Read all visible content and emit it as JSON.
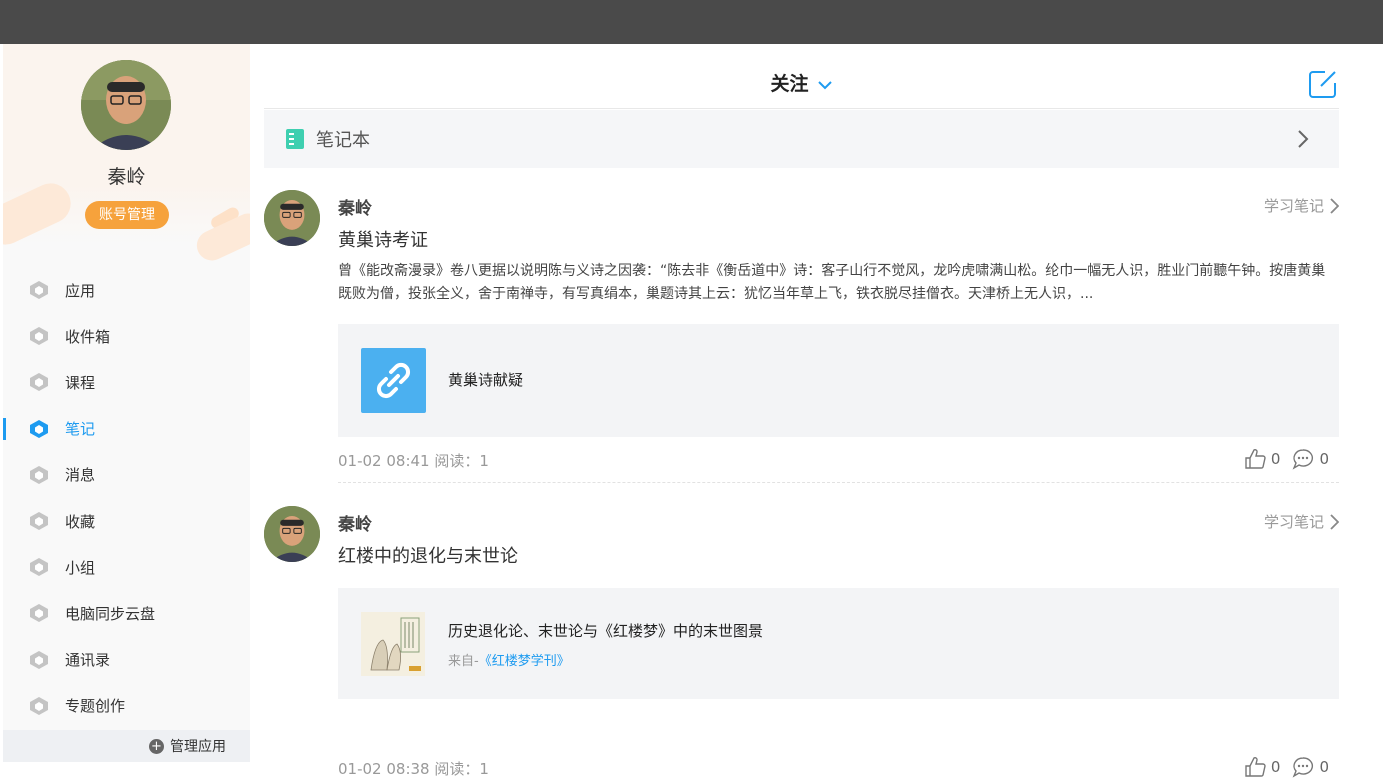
{
  "profile": {
    "name": "秦岭",
    "account_button": "账号管理"
  },
  "menu": [
    {
      "label": "应用",
      "active": false
    },
    {
      "label": "收件箱",
      "active": false
    },
    {
      "label": "课程",
      "active": false
    },
    {
      "label": "笔记",
      "active": true
    },
    {
      "label": "消息",
      "active": false
    },
    {
      "label": "收藏",
      "active": false
    },
    {
      "label": "小组",
      "active": false
    },
    {
      "label": "电脑同步云盘",
      "active": false
    },
    {
      "label": "通讯录",
      "active": false
    },
    {
      "label": "专题创作",
      "active": false
    }
  ],
  "manage_apps": "管理应用",
  "header": {
    "title": "关注"
  },
  "notebook": {
    "label": "笔记本"
  },
  "colors": {
    "accent": "#1e9bf0",
    "account_button": "#f6a23c",
    "topbar": "#4a4a4a",
    "notebook_icon": "#3ecfb0"
  },
  "posts": [
    {
      "author": "秦岭",
      "category": "学习笔记",
      "title": "黄巢诗考证",
      "body": "曾《能改斋漫录》卷八更据以说明陈与义诗之因袭：“陈去非《衡岳道中》诗：客子山行不觉风，龙吟虎啸满山松。纶巾一幅无人识，胜业门前聽午钟。按唐黄巢既败为僧，投张全义，舍于南禅寺，有写真绢本，巢题诗其上云：犹忆当年草上飞，铁衣脱尽挂僧衣。天津桥上无人识，...",
      "attachment": {
        "type": "link",
        "title": "黄巢诗献疑"
      },
      "meta": "01-02 08:41 阅读：1",
      "likes": "0",
      "comments": "0"
    },
    {
      "author": "秦岭",
      "category": "学习笔记",
      "title": "红楼中的退化与末世论",
      "body": "",
      "attachment": {
        "type": "book",
        "title": "历史退化论、末世论与《红楼梦》中的末世图景",
        "source_prefix": "来自-",
        "source": "《红楼梦学刊》"
      },
      "meta": "01-02 08:38 阅读：1",
      "likes": "0",
      "comments": "0"
    }
  ]
}
